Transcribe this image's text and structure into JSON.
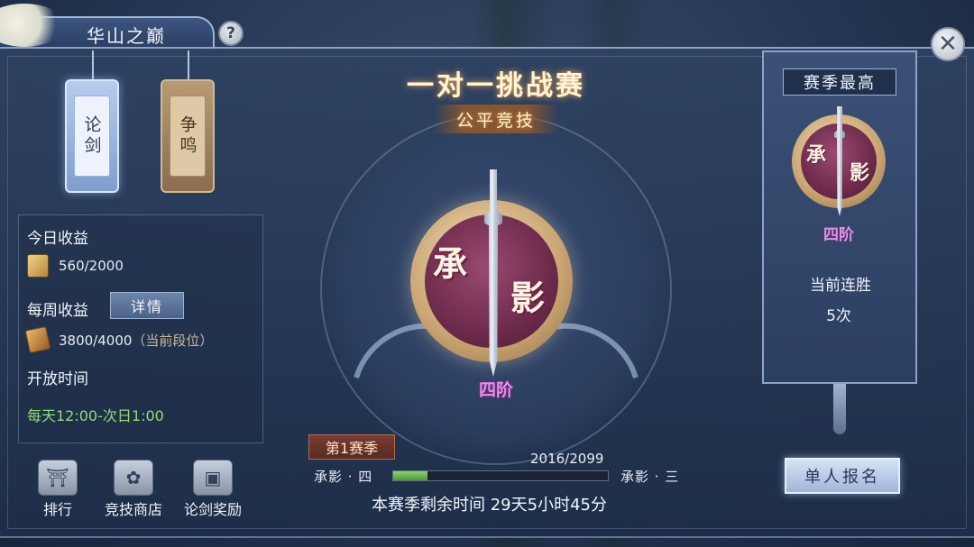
{
  "header": {
    "title": "华山之巅",
    "help_label": "?",
    "close_label": "✕"
  },
  "tags": [
    {
      "label": "论剑",
      "active": true
    },
    {
      "label": "争鸣",
      "active": false
    }
  ],
  "income": {
    "today_label": "今日收益",
    "today_value": "560/2000",
    "weekly_label": "每周收益",
    "detail_button": "详情",
    "weekly_value": "3800/4000",
    "weekly_note": "（当前段位）",
    "open_label": "开放时间",
    "open_value": "每天12:00-次日1:00"
  },
  "bottom_nav": [
    {
      "label": "排行",
      "icon": "pavilion-icon"
    },
    {
      "label": "竞技商店",
      "icon": "money-bag-icon"
    },
    {
      "label": "论剑奖励",
      "icon": "treasure-chest-icon"
    }
  ],
  "center": {
    "title": "一对一挑战赛",
    "subtitle": "公平竞技",
    "emblem_char_1": "承",
    "emblem_char_2": "影",
    "rank": "四阶"
  },
  "season": {
    "tag": "第1赛季",
    "rank_from": "承影 · 四",
    "rank_to": "承影 · 三",
    "progress_text": "2016/2099",
    "progress_fraction": 0.16,
    "remaining": "本赛季剩余时间 29天5小时45分"
  },
  "right_panel": {
    "heading": "赛季最高",
    "emblem_char_1": "承",
    "emblem_char_2": "影",
    "rank": "四阶",
    "streak_label": "当前连胜",
    "streak_value": "5次"
  },
  "signup_button": "单人报名",
  "colors": {
    "accent_pink": "#f08ae6",
    "progress_green": "#6bbd4c",
    "open_time_green": "#8fdc7a"
  }
}
